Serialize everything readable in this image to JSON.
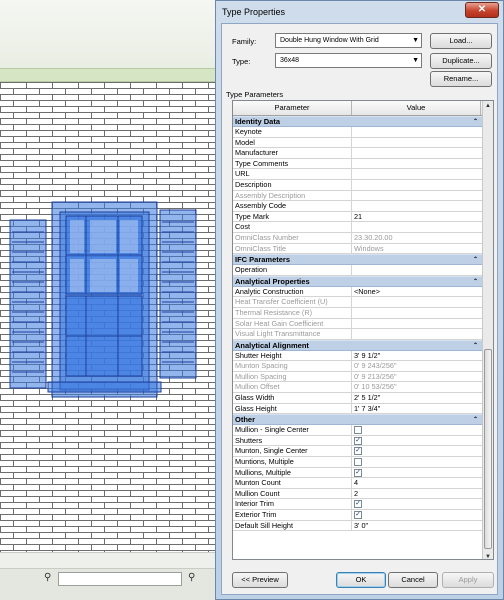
{
  "dialog": {
    "title": "Type Properties",
    "close_label": "✕",
    "family_label": "Family:",
    "family_value": "Double Hung Window With Grid",
    "type_label": "Type:",
    "type_value": "36x48",
    "load_label": "Load...",
    "duplicate_label": "Duplicate...",
    "rename_label": "Rename...",
    "type_parameters_label": "Type Parameters",
    "col_parameter": "Parameter",
    "col_value": "Value",
    "preview_label": "<< Preview",
    "ok_label": "OK",
    "cancel_label": "Cancel",
    "apply_label": "Apply"
  },
  "groups": [
    {
      "name": "Identity Data",
      "rows": [
        {
          "p": "Keynote",
          "v": ""
        },
        {
          "p": "Model",
          "v": ""
        },
        {
          "p": "Manufacturer",
          "v": ""
        },
        {
          "p": "Type Comments",
          "v": ""
        },
        {
          "p": "URL",
          "v": ""
        },
        {
          "p": "Description",
          "v": ""
        },
        {
          "p": "Assembly Description",
          "v": "",
          "dim": true
        },
        {
          "p": "Assembly Code",
          "v": ""
        },
        {
          "p": "Type Mark",
          "v": "21"
        },
        {
          "p": "Cost",
          "v": ""
        },
        {
          "p": "OmniClass Number",
          "v": "23.30.20.00",
          "dim": true
        },
        {
          "p": "OmniClass Title",
          "v": "Windows",
          "dim": true
        }
      ]
    },
    {
      "name": "IFC Parameters",
      "rows": [
        {
          "p": "Operation",
          "v": ""
        }
      ]
    },
    {
      "name": "Analytical Properties",
      "rows": [
        {
          "p": "Analytic Construction",
          "v": "<None>"
        },
        {
          "p": "Heat Transfer Coefficient (U)",
          "v": "",
          "dim": true
        },
        {
          "p": "Thermal Resistance (R)",
          "v": "",
          "dim": true
        },
        {
          "p": "Solar Heat Gain Coefficient",
          "v": "",
          "dim": true
        },
        {
          "p": "Visual Light Transmittance",
          "v": "",
          "dim": true
        }
      ]
    },
    {
      "name": "Analytical Alignment",
      "rows": [
        {
          "p": "Shutter Height",
          "v": "3'  9 1/2\""
        },
        {
          "p": "Munton Spacing",
          "v": "0'  9 243/256\"",
          "dim": true
        },
        {
          "p": "Mullion Spacing",
          "v": "0'  9 213/256\"",
          "dim": true
        },
        {
          "p": "Mullion Offset",
          "v": "0'  10 53/256\"",
          "dim": true
        },
        {
          "p": "Glass Width",
          "v": "2'  5 1/2\""
        },
        {
          "p": "Glass Height",
          "v": "1'  7 3/4\""
        }
      ]
    },
    {
      "name": "Other",
      "rows": [
        {
          "p": "Mullion - Single Center",
          "check": false
        },
        {
          "p": "Shutters",
          "check": true
        },
        {
          "p": "Munton, Single Center",
          "check": true
        },
        {
          "p": "Muntions, Multiple",
          "check": false
        },
        {
          "p": "Mullions, Multiple",
          "check": true
        },
        {
          "p": "Munton Count",
          "v": "4"
        },
        {
          "p": "Mullion Count",
          "v": "2"
        },
        {
          "p": "Interior Trim",
          "check": true
        },
        {
          "p": "Exterior Trim",
          "check": true
        },
        {
          "p": "Default Sill Height",
          "v": "3'  0\""
        }
      ]
    }
  ],
  "colors": {
    "selection_blue": "#3a78e0",
    "group_header": "#bed0e6"
  }
}
